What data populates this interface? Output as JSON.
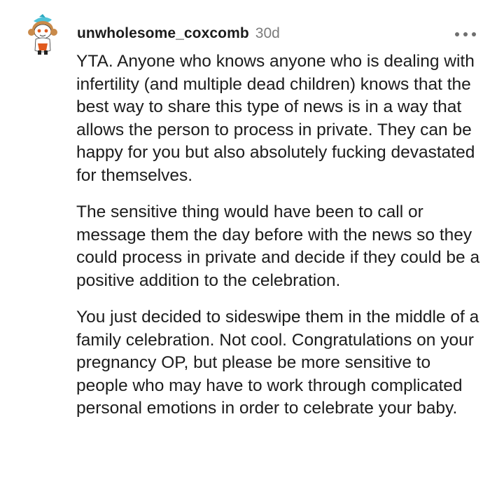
{
  "comment": {
    "author": "unwholesome_coxcomb",
    "age": "30d",
    "avatar_icon": "snoo-avatar-icon",
    "more_icon": "more-options-icon",
    "paragraphs": [
      "YTA. Anyone who knows anyone who is dealing with infertility (and multiple dead children) knows that the best way to share this type of news is in a way that allows the person to process in private. They can be happy for you but also absolutely fucking devastated for themselves.",
      "The sensitive thing would have been to call or message them the day before with the news so they could process in private and decide if they could be a positive addition to the celebration.",
      "You just decided to sideswipe them in the middle of a family celebration. Not cool. Congratulations on your pregnancy OP, but please be more sensitive to people who may have to work through complicated personal emotions in order to celebrate your baby."
    ]
  }
}
